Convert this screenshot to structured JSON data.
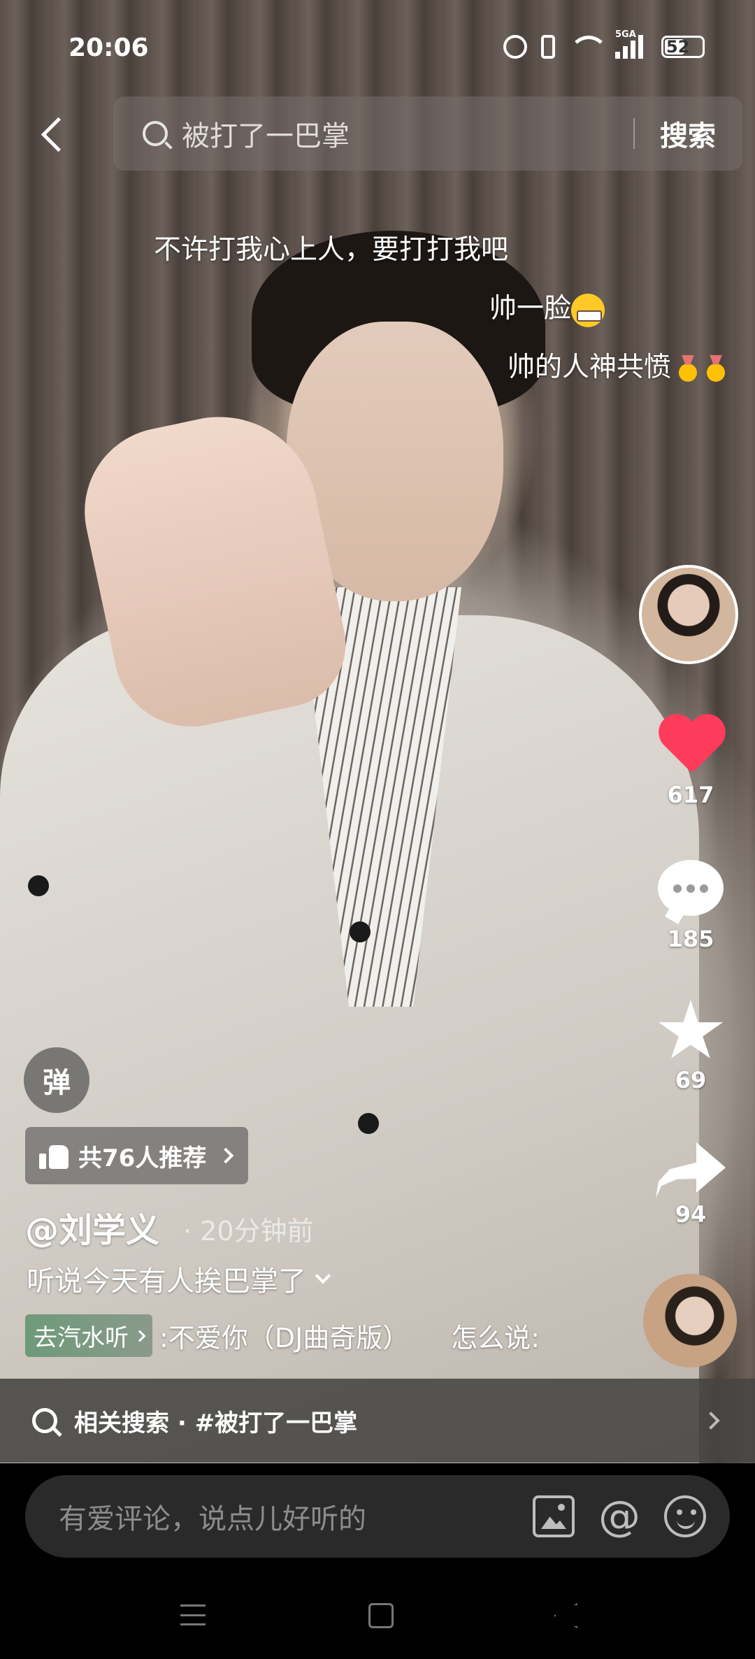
{
  "status_bar": {
    "time": "20:06",
    "network": "5GA",
    "battery": "52"
  },
  "search": {
    "query": "被打了一巴掌",
    "button": "搜索"
  },
  "danmaku": [
    "不许打我心上人，要打打我吧",
    "帅一脸",
    "帅的人神共愤"
  ],
  "rail": {
    "likes": "617",
    "comments": "185",
    "favorites": "69",
    "shares": "94"
  },
  "danmaku_toggle": "弹",
  "recommend": "共76人推荐",
  "author": "@刘学义",
  "post_time": "· 20分钟前",
  "caption": "听说今天有人挨巴掌了",
  "music": {
    "tag": "去汽水听",
    "title": ":不爱你（DJ曲奇版）",
    "title_next": "怎么说:"
  },
  "related_search": "相关搜索 · #被打了一巴掌",
  "comment_placeholder": "有爱评论，说点儿好听的",
  "comment_at_symbol": "@",
  "colors": {
    "like": "#ff3b5c",
    "music_tag": "#6e9a7a"
  },
  "icons": [
    "back-icon",
    "search-icon",
    "heart-icon",
    "comment-icon",
    "star-icon",
    "share-icon",
    "thumbs-up-icon",
    "image-icon",
    "at-icon",
    "emoji-icon"
  ]
}
